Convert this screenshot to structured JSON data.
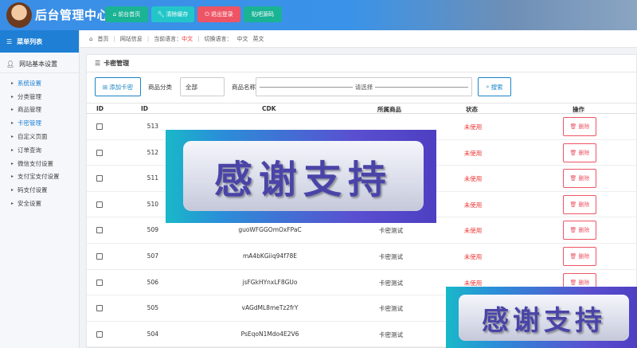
{
  "app": {
    "title": "后台管理中心"
  },
  "topbar": {
    "buttons": [
      {
        "label": "前台首页",
        "icon": "home-icon"
      },
      {
        "label": "清除缓存",
        "icon": "wrench-icon"
      },
      {
        "label": "退出登录",
        "icon": "power-icon"
      },
      {
        "label": "贴吧源码",
        "icon": ""
      }
    ]
  },
  "sidebar": {
    "header": "菜单列表",
    "group": "网站基本设置",
    "items": [
      {
        "label": "系统设置",
        "active": true
      },
      {
        "label": "分类管理",
        "active": false
      },
      {
        "label": "商品管理",
        "active": false
      },
      {
        "label": "卡密管理",
        "active": true
      },
      {
        "label": "自定义页面",
        "active": false
      },
      {
        "label": "订单查询",
        "active": false
      },
      {
        "label": "微信支付设置",
        "active": false
      },
      {
        "label": "支付宝支付设置",
        "active": false
      },
      {
        "label": "码支付设置",
        "active": false
      },
      {
        "label": "安全设置",
        "active": false
      }
    ]
  },
  "breadcrumb": {
    "home": "首页",
    "site_info": "网站信息",
    "current_lang_label": "当前语言：",
    "current_lang": "中文",
    "switch_lang_label": "切换语言：",
    "lang_zh": "中文",
    "lang_en": "英文"
  },
  "panel": {
    "title": "卡密管理",
    "add_button": "添加卡密",
    "category_label": "商品分类",
    "category_value": "全部",
    "name_label": "商品名称",
    "name_placeholder": "请选择",
    "search_button": "搜索"
  },
  "table": {
    "headers": {
      "check": "ID",
      "id": "ID",
      "cdk": "CDK",
      "product": "所属商品",
      "status": "状态",
      "action": "操作"
    },
    "delete_label": "删除",
    "rows": [
      {
        "id": "513",
        "cdk": "",
        "product": "",
        "status": "未使用"
      },
      {
        "id": "512",
        "cdk": "",
        "product": "",
        "status": "未使用"
      },
      {
        "id": "511",
        "cdk": "",
        "product": "",
        "status": "未使用"
      },
      {
        "id": "510",
        "cdk": "",
        "product": "",
        "status": "未使用"
      },
      {
        "id": "509",
        "cdk": "guoWFGGOmOxFPaC",
        "product": "卡密测试",
        "status": "未使用"
      },
      {
        "id": "507",
        "cdk": "mA4bKGiiq94f78E",
        "product": "卡密测试",
        "status": "未使用"
      },
      {
        "id": "506",
        "cdk": "jsFGkHYnxLF8GUo",
        "product": "卡密测试",
        "status": "未使用"
      },
      {
        "id": "505",
        "cdk": "vAGdML8meTz2frY",
        "product": "卡密测试",
        "status": ""
      },
      {
        "id": "504",
        "cdk": "PsEqoN1Mdo4E2V6",
        "product": "卡密测试",
        "status": ""
      }
    ]
  },
  "overlays": {
    "text_large": "感谢支持",
    "text_small": "感谢支持"
  }
}
